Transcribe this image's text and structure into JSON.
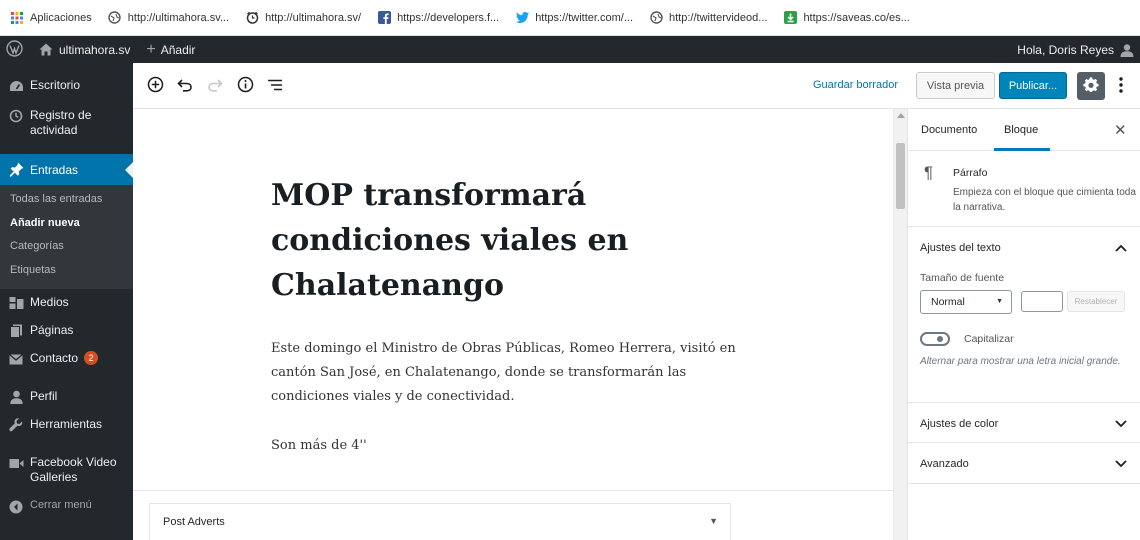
{
  "bookmarks": [
    {
      "label": "Aplicaciones",
      "icon": "apps-grid-icon"
    },
    {
      "label": "http://ultimahora.sv...",
      "icon": "globe-icon"
    },
    {
      "label": "http://ultimahora.sv/",
      "icon": "clock-icon"
    },
    {
      "label": "https://developers.f...",
      "icon": "facebook-icon"
    },
    {
      "label": "https://twitter.com/...",
      "icon": "twitter-icon"
    },
    {
      "label": "http://twittervideod...",
      "icon": "globe-icon"
    },
    {
      "label": "https://saveas.co/es...",
      "icon": "download-icon"
    }
  ],
  "adminbar": {
    "site_name": "ultimahora.sv",
    "add_new": "Añadir",
    "greeting": "Hola, Doris Reyes"
  },
  "sidebar": {
    "items": [
      {
        "label": "Escritorio",
        "icon": "dashboard-icon"
      },
      {
        "label": "Registro de actividad",
        "icon": "history-icon"
      },
      {
        "label": "Entradas",
        "icon": "pin-icon"
      },
      {
        "label": "Medios",
        "icon": "media-icon"
      },
      {
        "label": "Páginas",
        "icon": "pages-icon"
      },
      {
        "label": "Contacto",
        "icon": "mail-icon",
        "badge": "2"
      },
      {
        "label": "Perfil",
        "icon": "user-icon"
      },
      {
        "label": "Herramientas",
        "icon": "wrench-icon"
      },
      {
        "label": "Facebook Video Galleries",
        "icon": "video-icon"
      },
      {
        "label": "Cerrar menú",
        "icon": "collapse-icon"
      }
    ],
    "submenu": [
      "Todas las entradas",
      "Añadir nueva",
      "Categorías",
      "Etiquetas"
    ]
  },
  "toolbar": {
    "save_draft": "Guardar borrador",
    "preview": "Vista previa",
    "publish": "Publicar..."
  },
  "post": {
    "title": "MOP transformará condiciones viales en Chalatenango",
    "paragraph1": "Este domingo el Ministro de Obras Públicas, Romeo Herrera, visitó en cantón San José, en Chalatenango, donde se transformarán las condiciones viales y de conectividad.",
    "paragraph2": "Son más de 4''"
  },
  "metabox": {
    "title": "Post Adverts"
  },
  "settings": {
    "tab_document": "Documento",
    "tab_block": "Bloque",
    "block_name": "Párrafo",
    "block_desc": "Empieza con el bloque que cimienta toda la narrativa.",
    "text_settings": "Ajustes del texto",
    "font_size_label": "Tamaño de fuente",
    "font_size_value": "Normal",
    "reset": "Restablecer",
    "dropcap_label": "Capitalizar",
    "dropcap_help": "Alternar para mostrar una letra inicial grande.",
    "color_settings": "Ajustes de color",
    "advanced": "Avanzado"
  },
  "colors": {
    "admin_bg": "#23282d",
    "active_blue": "#0073aa",
    "publish_blue": "#0085ba"
  }
}
